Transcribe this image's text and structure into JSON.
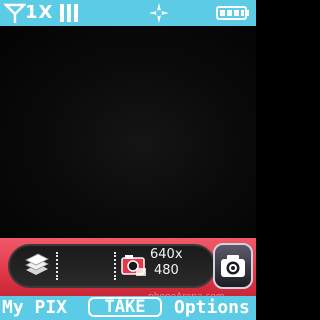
{
  "status_bar": {
    "network_label": "1X",
    "signal_icon": "signal-antenna-icon",
    "roaming_icon": "diamond-roam-icon",
    "battery_icon": "battery-icon",
    "signal_bars": 3
  },
  "camera_bar": {
    "mode_icon": "photo-stack-icon",
    "resolution_icon": "resolution-icon",
    "resolution_line1": "640x",
    "resolution_line2": "480",
    "capture_icon": "camera-icon"
  },
  "watermark": "phoneArena.com",
  "softkeys": {
    "left": "My PIX",
    "center": "TAKE",
    "right": "Options"
  },
  "colors": {
    "status_bg": "#5ccbe6",
    "control_bg": "#e23a4a",
    "viewfinder_bg": "#0b0b0b"
  }
}
